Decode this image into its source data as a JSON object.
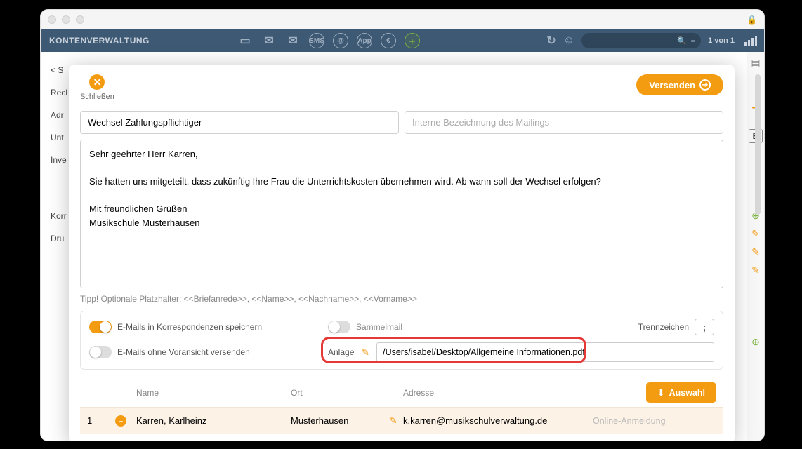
{
  "toolbar": {
    "title": "KONTENVERWALTUNG",
    "count": "1 von 1"
  },
  "bg": {
    "items": [
      "< S",
      "Recl",
      "Adr",
      "Unt",
      "Inve",
      "Korr",
      "Dru"
    ],
    "right_marker": "B"
  },
  "modal": {
    "close_label": "Schließen",
    "send_label": "Versenden",
    "subject_value": "Wechsel Zahlungspflichtiger",
    "mailing_placeholder": "Interne Bezeichnung des Mailings",
    "body": "Sehr geehrter Herr Karren,\n\nSie hatten uns mitgeteilt, dass zukünftig Ihre Frau die Unterrichtskosten übernehmen wird. Ab wann soll der Wechsel erfolgen?\n\nMit freundlichen Grüßen\nMusikschule Musterhausen",
    "tipp": "Tipp! Optionale Platzhalter: <<Briefanrede>>, <<Name>>, <<Nachname>>, <<Vorname>>",
    "opt_save": "E-Mails in Korrespondenzen speichern",
    "opt_send_noview": "E-Mails ohne Voransicht versenden",
    "opt_sammel": "Sammelmail",
    "trenn_label": "Trennzeichen",
    "trenn_value": ";",
    "anlage_label": "Anlage",
    "anlage_value": "/Users/isabel/Desktop/Allgemeine Informationen.pdf",
    "table": {
      "h_name": "Name",
      "h_ort": "Ort",
      "h_adresse": "Adresse",
      "auswahl": "Auswahl",
      "rows": [
        {
          "idx": "1",
          "name": "Karren, Karlheinz",
          "ort": "Musterhausen",
          "email": "k.karren@musikschulverwaltung.de",
          "tag": "Online-Anmeldung"
        }
      ]
    }
  }
}
